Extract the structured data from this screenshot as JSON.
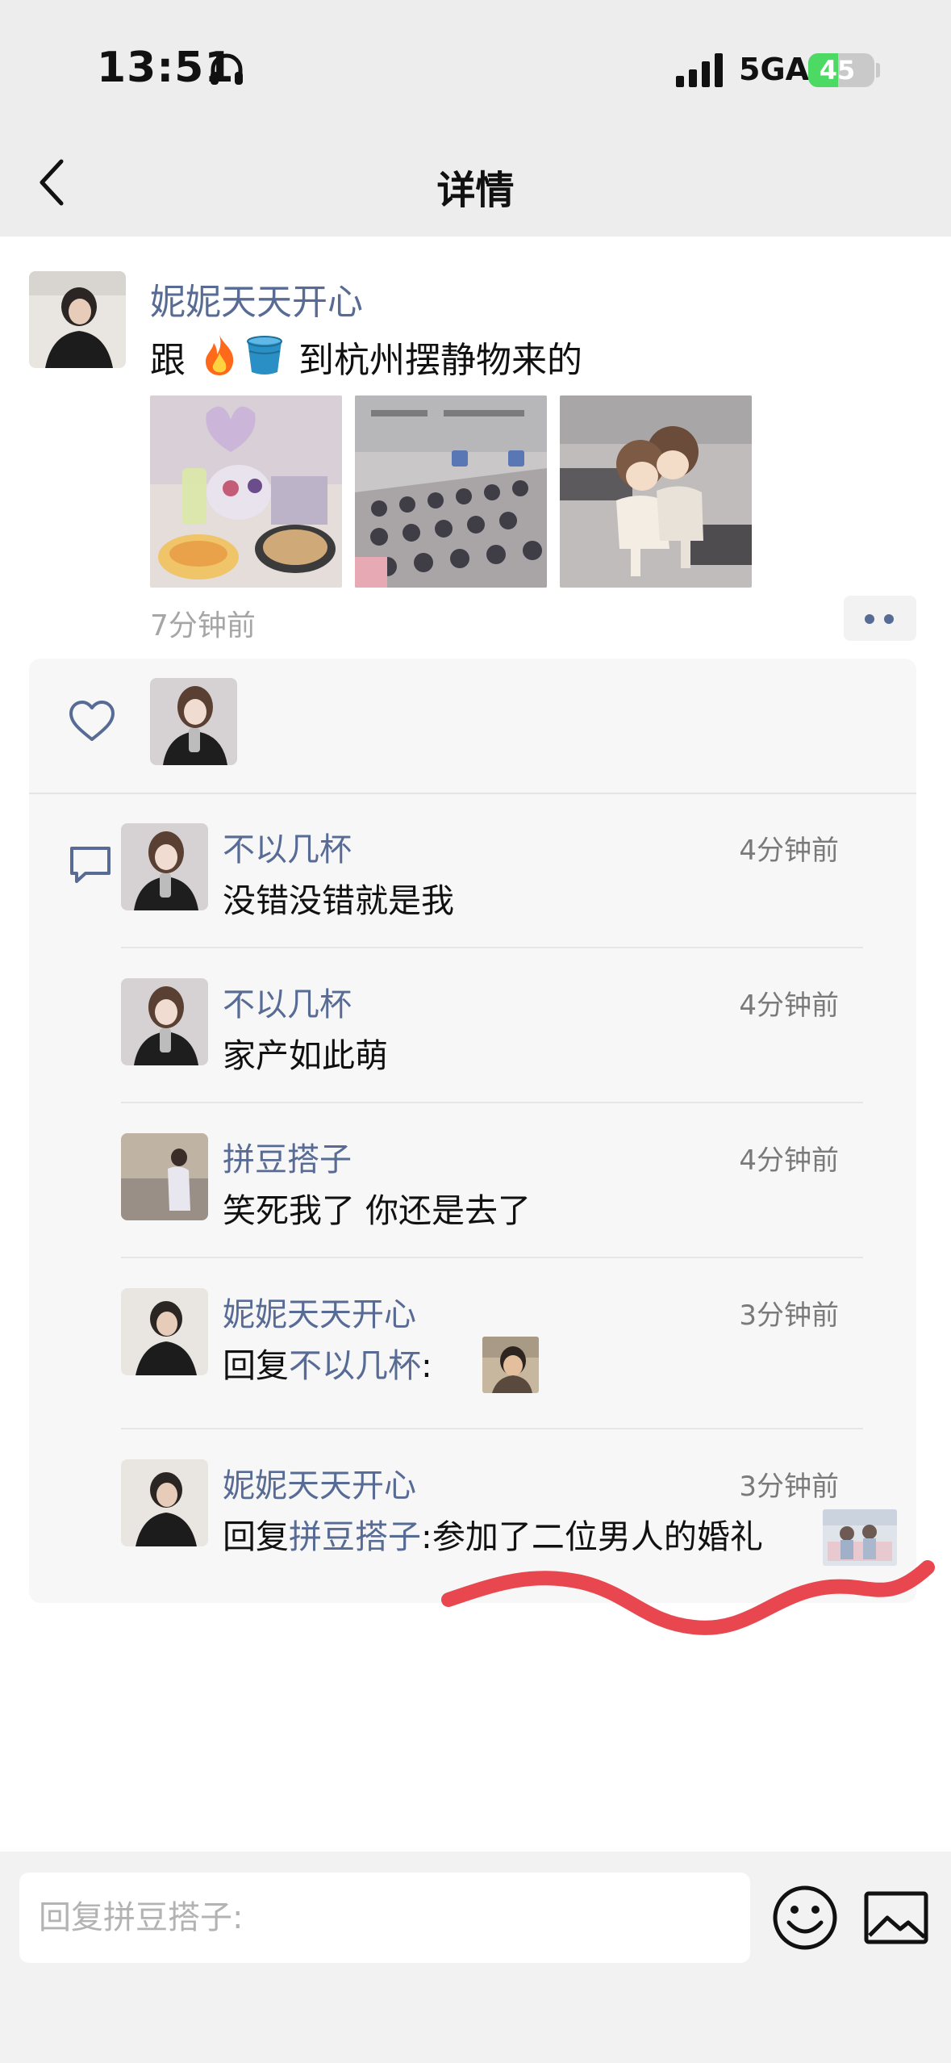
{
  "status_bar": {
    "time": "13:51",
    "network": "5GA",
    "battery_percent": "45",
    "battery_level": 0.45,
    "icons": [
      "headphones-icon",
      "signal-icon",
      "battery-charging-icon"
    ]
  },
  "nav": {
    "title": "详情",
    "back_icon": "chevron-left-icon"
  },
  "post": {
    "author": "妮妮天天开心",
    "text_prefix": "跟",
    "text_emoji": [
      "fire-emoji",
      "bucket-emoji"
    ],
    "text_suffix": "到杭州摆静物来的",
    "photo_count": 3,
    "time": "7分钟前",
    "more_icon": "more-dots-icon"
  },
  "likes": {
    "icon": "heart-icon",
    "count": 1
  },
  "comments_icon": "comment-icon",
  "comments": [
    {
      "author": "不以几杯",
      "time": "4分钟前",
      "text": "没错没错就是我"
    },
    {
      "author": "不以几杯",
      "time": "4分钟前",
      "text": "家产如此萌"
    },
    {
      "author": "拼豆搭子",
      "time": "4分钟前",
      "text": "笑死我了 你还是去了"
    },
    {
      "author": "妮妮天天开心",
      "time": "3分钟前",
      "reply_label": "回复",
      "reply_to": "不以几杯",
      "colon": ":",
      "text": ""
    },
    {
      "author": "妮妮天天开心",
      "time": "3分钟前",
      "reply_label": "回复",
      "reply_to": "拼豆搭子",
      "colon": ":",
      "text": "参加了二位男人的婚礼"
    }
  ],
  "input": {
    "placeholder": "回复拼豆搭子:",
    "emoji_icon": "emoji-face-icon",
    "image_icon": "image-icon"
  },
  "colors": {
    "link": "#576b95",
    "nav_bg": "#ededed",
    "panel_bg": "#f7f7f7",
    "annotation_red": "#e8474f"
  }
}
